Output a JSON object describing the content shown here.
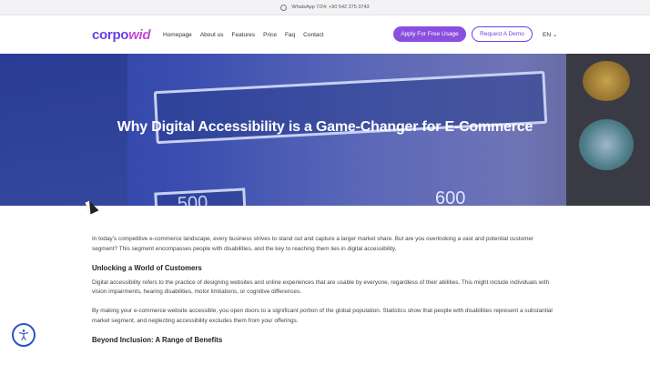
{
  "topbar": {
    "whatsapp": "WhatsApp 7/24: +90 542 375 3743"
  },
  "brand": {
    "part1": "corpo",
    "part2": "wid"
  },
  "nav": {
    "items": [
      "Homepage",
      "About us",
      "Features",
      "Price",
      "Faq",
      "Contact"
    ],
    "apply_label": "Apply For Free Usage",
    "demo_label": "Request A Demo",
    "language": "EN"
  },
  "hero": {
    "title": "Why Digital Accessibility is a Game-Changer for E-Commerce",
    "sign_small": "500",
    "sign_num": "600"
  },
  "article": {
    "intro": "In today’s competitive e-commerce landscape, every business strives to stand out and capture a larger market share. But are you overlooking a vast and potential customer segment?  This segment encompasses people with disabilities, and the key to reaching them lies in digital accessibility.",
    "heading1": "Unlocking a World of Customers",
    "para1": "Digital accessibility refers to the practice of designing websites and online experiences that are usable by everyone, regardless of their abilities. This might include individuals with vision impairments, hearing disabilities, motor limitations, or cognitive differences.",
    "para2": "By making your e-commerce website accessible, you open doors to a significant portion of the global population. Statistics show that people with disabilities represent a substantial market segment, and neglecting accessibility excludes them from your offerings.",
    "heading2": "Beyond Inclusion: A Range of Benefits"
  }
}
